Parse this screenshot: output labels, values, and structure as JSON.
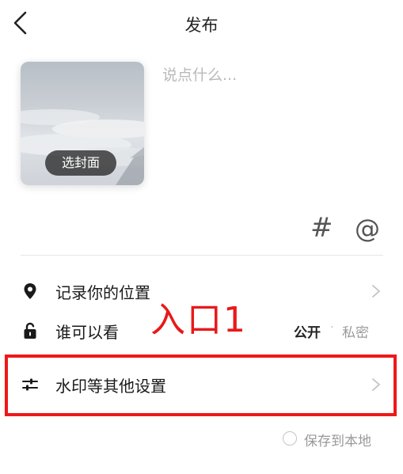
{
  "header": {
    "title": "发布",
    "back_icon": "chevron-left-icon"
  },
  "cover": {
    "button_label": "选封面"
  },
  "caption": {
    "placeholder": "说点什么..."
  },
  "tools": {
    "hashtag": "#",
    "mention": "@"
  },
  "rows": {
    "location": {
      "label": "记录你的位置",
      "icon": "location-pin-icon"
    },
    "visibility": {
      "label": "谁可以看",
      "icon": "unlock-icon",
      "public": "公开",
      "separator": "·",
      "private": "私密"
    },
    "watermark": {
      "label": "水印等其他设置",
      "icon": "sliders-icon"
    }
  },
  "annotation": {
    "text": "入口1",
    "color": "#e8191a"
  },
  "save_local": {
    "label": "保存到本地",
    "checked": false
  },
  "colors": {
    "accent_red": "#ef1818"
  }
}
